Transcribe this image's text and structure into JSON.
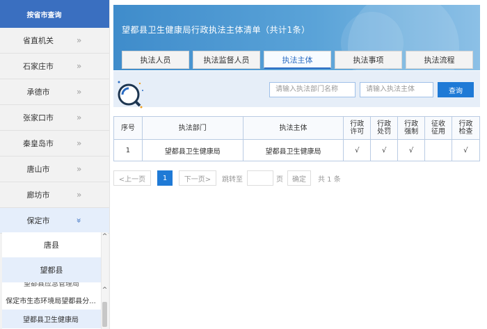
{
  "sidebar": {
    "header": "按省市查询",
    "items": [
      {
        "label": "省直机关",
        "arrow": "»"
      },
      {
        "label": "石家庄市",
        "arrow": "»"
      },
      {
        "label": "承德市",
        "arrow": "»"
      },
      {
        "label": "张家口市",
        "arrow": "»"
      },
      {
        "label": "秦皇岛市",
        "arrow": "»"
      },
      {
        "label": "唐山市",
        "arrow": "»"
      },
      {
        "label": "廊坊市",
        "arrow": "»"
      },
      {
        "label": "保定市",
        "arrow": "»"
      }
    ],
    "sub_counties": [
      "唐县",
      "望都县"
    ],
    "sub_orgs_cut": "望都县应急管理局",
    "sub_orgs": [
      "保定市生态环境局望都县分...",
      "望都县卫生健康局"
    ],
    "scroll_up": "^"
  },
  "banner": {
    "title": "望都县卫生健康局行政执法主体清单（共计1条）"
  },
  "tabs": [
    "执法人员",
    "执法监督人员",
    "执法主体",
    "执法事项",
    "执法流程"
  ],
  "search": {
    "dept_placeholder": "请输入执法部门名称",
    "subject_placeholder": "请输入执法主体",
    "button": "查询"
  },
  "table": {
    "headers": {
      "index": "序号",
      "dept": "执法部门",
      "subject": "执法主体",
      "c1": "行政\n许可",
      "c2": "行政\n处罚",
      "c3": "行政\n强制",
      "c4": "征收\n征用",
      "c5": "行政\n检查"
    },
    "rows": [
      {
        "index": "1",
        "dept": "望都县卫生健康局",
        "subject": "望都县卫生健康局",
        "c1": "√",
        "c2": "√",
        "c3": "√",
        "c4": "",
        "c5": "√"
      }
    ]
  },
  "pager": {
    "prev": "<上一页",
    "current": "1",
    "next": "下一页>",
    "jump": "跳转至",
    "page_unit": "页",
    "confirm": "确定",
    "total": "共 1 条"
  },
  "colors": {
    "accent": "#1f7ad6",
    "sidebar_header": "#3a6fc0",
    "banner": "#4a95d0"
  }
}
